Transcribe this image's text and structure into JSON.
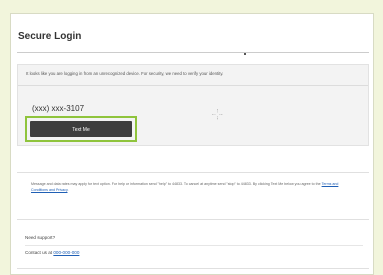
{
  "login": {
    "title": "Secure Login",
    "notice": "It looks like you are logging in from an unrecognized device. For security, we need to verify your identity.",
    "phone": "(xxx) xxx-3107",
    "button_label": "Text Me"
  },
  "disclaimer": {
    "text": "Message and data rates may apply for text option. For help or information send \"help\" to 44833. To cancel at anytime send \"stop\" to 44833. By clicking Text Me below you agree to the",
    "terms_link": "Terms and Conditions and Privacy",
    "suffix": "."
  },
  "support": {
    "title": "Need support?",
    "contact_prefix": "Contact us at",
    "phone_link": "000-000-000"
  },
  "colors": {
    "background": "#f2f5dc",
    "button": "#3e3e3e",
    "highlight": "#8fc43c",
    "link": "#1f5fb5"
  }
}
